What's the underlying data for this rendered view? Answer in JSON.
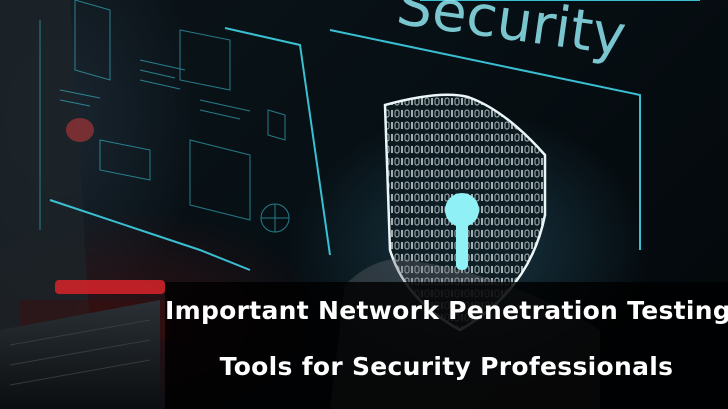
{
  "image": {
    "screen_text": "Security",
    "icon": "shield-lock-icon",
    "accent_color": "#3fd3e6"
  },
  "caption": {
    "line1": "Important Network Penetration Testing",
    "line2": "Tools for Security Professionals"
  }
}
